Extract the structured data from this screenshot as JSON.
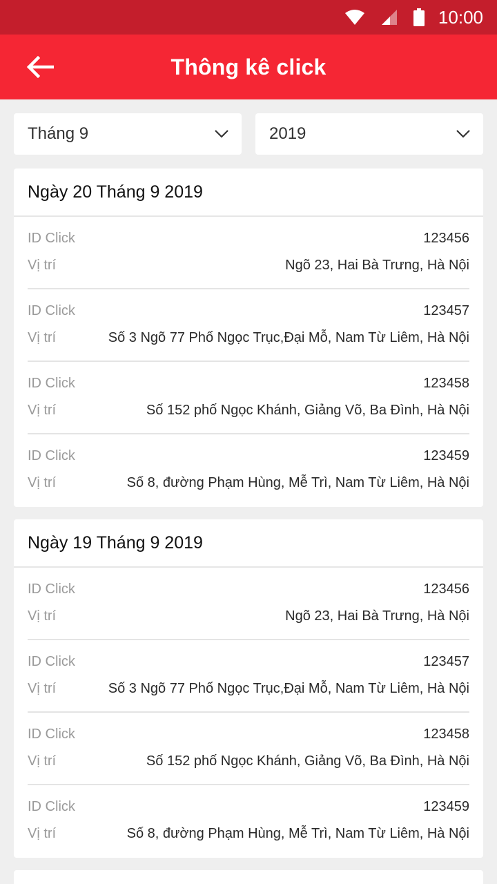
{
  "status": {
    "time": "10:00"
  },
  "header": {
    "title": "Thông kê click"
  },
  "filters": {
    "month": "Tháng 9",
    "year": "2019"
  },
  "groups": [
    {
      "date": "Ngày 20 Tháng 9 2019",
      "entries": [
        {
          "id_label": "ID Click",
          "id": "123456",
          "loc_label": "Vị trí",
          "location": "Ngõ 23, Hai Bà Trưng, Hà Nội"
        },
        {
          "id_label": "ID Click",
          "id": "123457",
          "loc_label": "Vị trí",
          "location": "Số 3 Ngõ 77 Phố Ngọc Trục,Đại Mỗ, Nam Từ Liêm, Hà Nội"
        },
        {
          "id_label": "ID Click",
          "id": "123458",
          "loc_label": "Vị trí",
          "location": "Số 152 phố Ngọc Khánh, Giảng Võ, Ba Đình, Hà Nội"
        },
        {
          "id_label": "ID Click",
          "id": "123459",
          "loc_label": "Vị trí",
          "location": "Số 8, đường Phạm Hùng, Mễ Trì, Nam Từ Liêm, Hà Nội"
        }
      ]
    },
    {
      "date": "Ngày 19 Tháng 9 2019",
      "entries": [
        {
          "id_label": "ID Click",
          "id": "123456",
          "loc_label": "Vị trí",
          "location": "Ngõ 23, Hai Bà Trưng, Hà Nội"
        },
        {
          "id_label": "ID Click",
          "id": "123457",
          "loc_label": "Vị trí",
          "location": "Số 3 Ngõ 77 Phố Ngọc Trục,Đại Mỗ, Nam Từ Liêm, Hà Nội"
        },
        {
          "id_label": "ID Click",
          "id": "123458",
          "loc_label": "Vị trí",
          "location": "Số 152 phố Ngọc Khánh, Giảng Võ, Ba Đình, Hà Nội"
        },
        {
          "id_label": "ID Click",
          "id": "123459",
          "loc_label": "Vị trí",
          "location": "Số 8, đường Phạm Hùng, Mễ Trì, Nam Từ Liêm, Hà Nội"
        }
      ]
    }
  ],
  "icons": {
    "back": "arrow-left-icon",
    "dropdown": "chevron-down-icon",
    "wifi": "wifi-icon",
    "signal": "signal-icon",
    "battery": "battery-icon"
  },
  "colors": {
    "status_bar": "#c41e2c",
    "app_bar": "#f52634",
    "background": "#efefef"
  }
}
